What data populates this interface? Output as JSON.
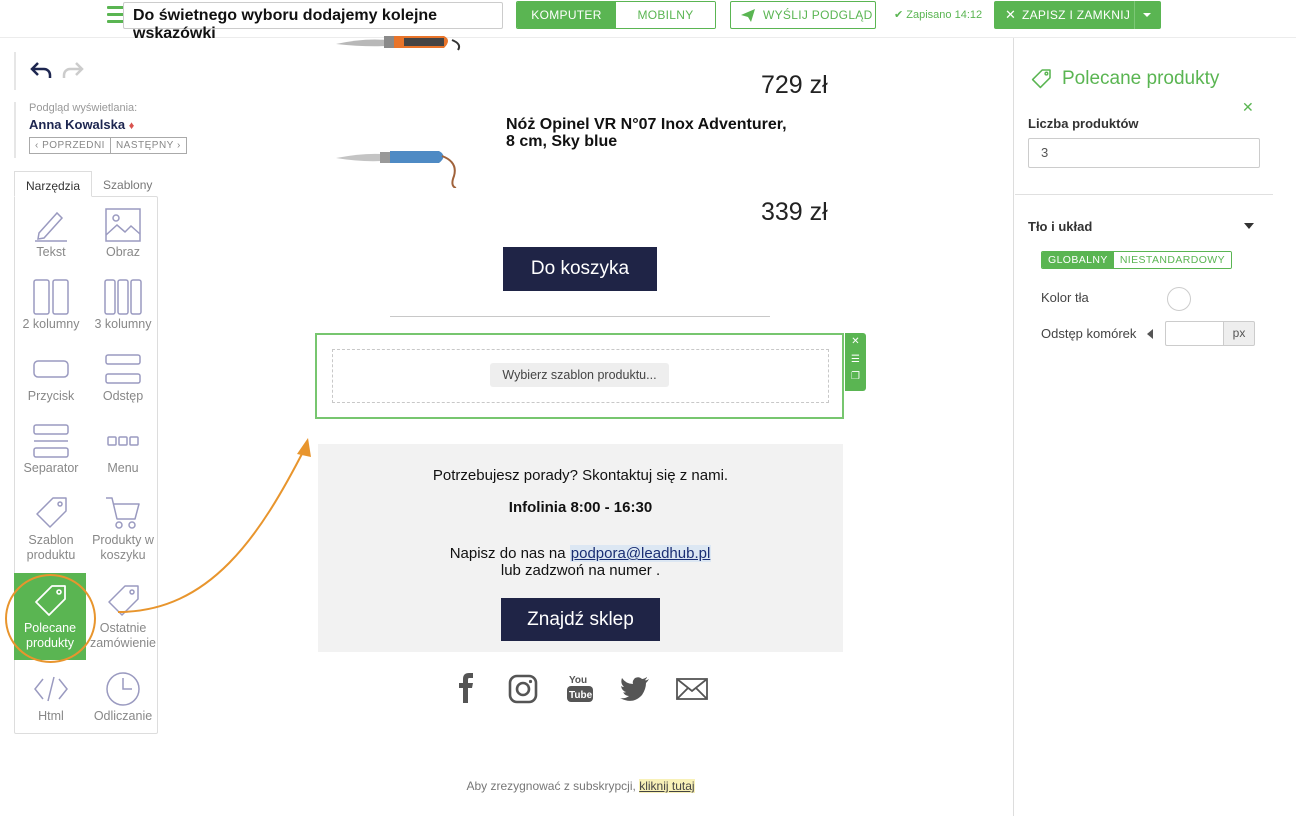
{
  "header": {
    "email_title": "Do świetnego wyboru dodajemy kolejne wskazówki",
    "device_computer": "KOMPUTER",
    "device_mobile": "MOBILNY",
    "send_preview": "WYŚLIJ PODGLĄD",
    "saved_status": "Zapisano 14:12",
    "save_close": "ZAPISZ I ZAMKNIJ"
  },
  "sidebar": {
    "preview_label": "Podgląd wyświetlania:",
    "preview_user": "Anna Kowalska",
    "prev_label": "POPRZEDNI",
    "next_label": "NASTĘPNY",
    "tabs": [
      "Narzędzia",
      "Szablony"
    ],
    "tools": {
      "text": "Tekst",
      "image": "Obraz",
      "two_columns": "2 kolumny",
      "three_columns": "3 kolumny",
      "button": "Przycisk",
      "spacer": "Odstęp",
      "separator": "Separator",
      "menu": "Menu",
      "product_template_1": "Szablon",
      "product_template_2": "produktu",
      "cart_products_1": "Produkty w",
      "cart_products_2": "koszyku",
      "recommended_1": "Polecane",
      "recommended_2": "produkty",
      "last_order_1": "Ostatnie",
      "last_order_2": "zamówienie",
      "html": "Html",
      "countdown": "Odliczanie"
    }
  },
  "canvas": {
    "price_1": "729 zł",
    "product_title": "Nóż Opinel VR N°07 Inox Adventurer, 8 cm, Sky blue",
    "price_2": "339 zł",
    "cart_button": "Do koszyka",
    "choose_template": "Wybierz szablon produktu...",
    "contact_line_1": "Potrzebujesz porady? Skontaktuj się z nami.",
    "contact_hours": "Infolinia 8:00 - 16:30",
    "contact_write": "Napisz do nas na",
    "contact_email": "podpora@leadhub.pl",
    "contact_call": "lub zadzwoń na numer .",
    "shop_button": "Znajdź sklep",
    "unsubscribe_text": "Aby zrezygnować z subskrypcji,",
    "unsubscribe_link": "kliknij tutaj"
  },
  "right_panel": {
    "title": "Polecane produkty",
    "count_label": "Liczba produktów",
    "count_value": "3",
    "section_title": "Tło i układ",
    "toggle_global": "GLOBALNY",
    "toggle_custom": "NIESTANDARDOWY",
    "bg_color_label": "Kolor tła",
    "cell_spacing_label": "Odstęp komórek",
    "unit": "px"
  },
  "colors": {
    "accent_green": "#5ab552",
    "dark_button": "#1f2446",
    "highlight_orange": "#e8952d"
  },
  "icons": [
    "hamburger-icon",
    "paper-plane-icon",
    "check-icon",
    "close-icon",
    "undo-icon",
    "redo-icon",
    "tag-icon",
    "facebook-icon",
    "instagram-icon",
    "youtube-icon",
    "twitter-icon",
    "mail-icon"
  ]
}
